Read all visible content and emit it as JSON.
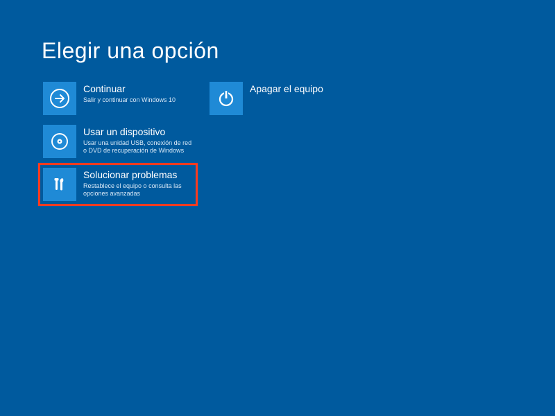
{
  "title": "Elegir una opción",
  "colors": {
    "background": "#005a9e",
    "tile": "#1f8ad6",
    "highlight": "#ff3b1f"
  },
  "options": {
    "continue": {
      "label": "Continuar",
      "sublabel": "Salir y continuar con Windows 10",
      "icon": "arrow-right-icon"
    },
    "use_device": {
      "label": "Usar un dispositivo",
      "sublabel": "Usar una unidad USB, conexión de red o DVD de recuperación de Windows",
      "icon": "disc-icon"
    },
    "troubleshoot": {
      "label": "Solucionar problemas",
      "sublabel": "Restablece el equipo o consulta las opciones avanzadas",
      "icon": "tools-icon",
      "highlighted": true
    },
    "shutdown": {
      "label": "Apagar el equipo",
      "sublabel": "",
      "icon": "power-icon"
    }
  }
}
